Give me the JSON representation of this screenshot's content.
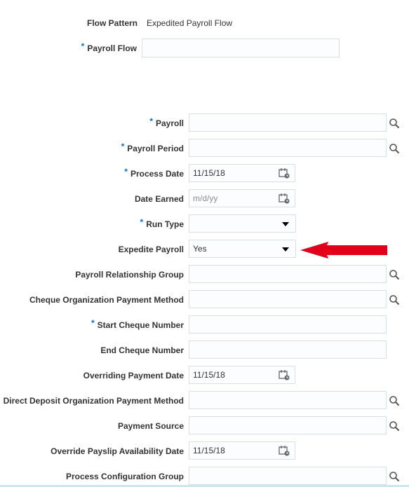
{
  "flow_pattern": {
    "label": "Flow Pattern",
    "value": "Expedited Payroll Flow"
  },
  "payroll_flow": {
    "label": "Payroll Flow",
    "required": "*",
    "value": ""
  },
  "fields": {
    "payroll": {
      "label": "Payroll",
      "required": "*",
      "value": ""
    },
    "payroll_period": {
      "label": "Payroll Period",
      "required": "*",
      "value": ""
    },
    "process_date": {
      "label": "Process Date",
      "required": "*",
      "value": "11/15/18"
    },
    "date_earned": {
      "label": "Date Earned",
      "value": "",
      "placeholder": "m/d/yy"
    },
    "run_type": {
      "label": "Run Type",
      "required": "*",
      "value": ""
    },
    "expedite_payroll": {
      "label": "Expedite Payroll",
      "value": "Yes"
    },
    "payroll_relationship_group": {
      "label": "Payroll Relationship Group",
      "value": ""
    },
    "cheque_org_payment_method": {
      "label": "Cheque Organization Payment Method",
      "value": ""
    },
    "start_cheque_number": {
      "label": "Start Cheque Number",
      "required": "*",
      "value": ""
    },
    "end_cheque_number": {
      "label": "End Cheque Number",
      "value": ""
    },
    "overriding_payment_date": {
      "label": "Overriding Payment Date",
      "value": "11/15/18"
    },
    "direct_deposit_org_payment_method": {
      "label": "Direct Deposit Organization Payment Method",
      "value": ""
    },
    "payment_source": {
      "label": "Payment Source",
      "value": ""
    },
    "override_payslip_availability_date": {
      "label": "Override Payslip Availability Date",
      "value": "11/15/18"
    },
    "process_configuration_group": {
      "label": "Process Configuration Group",
      "value": ""
    }
  },
  "icons": {
    "search": "search-icon",
    "calendar": "calendar-icon",
    "dropdown": "chevron-down-icon",
    "annotation": "red-arrow"
  },
  "colors": {
    "required_asterisk": "#0572ce",
    "annotation_arrow": "#e2001a",
    "field_border": "#d6dfe6"
  }
}
